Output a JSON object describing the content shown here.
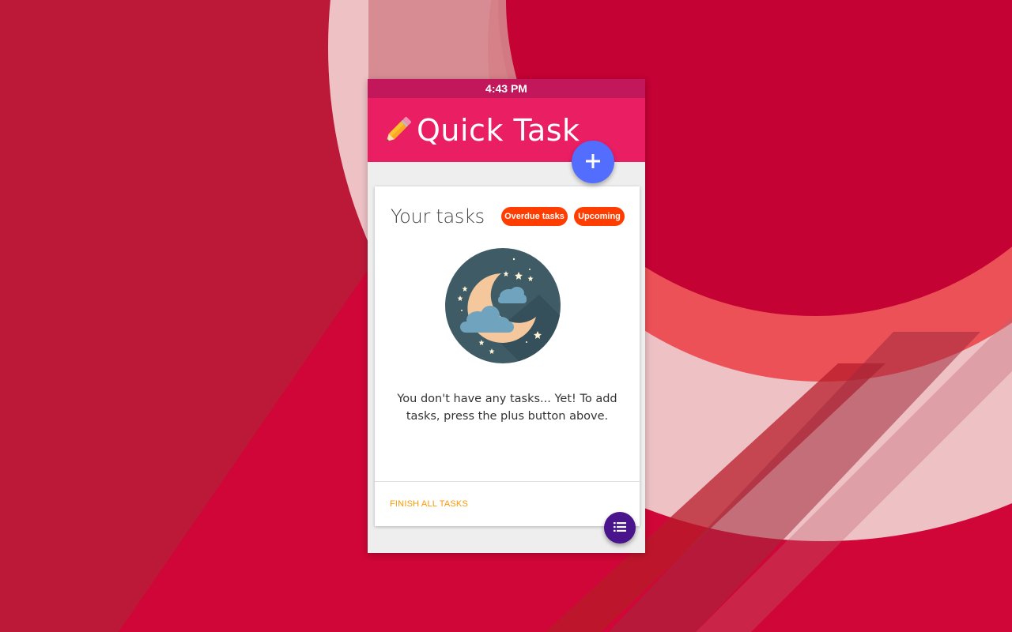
{
  "status_bar": {
    "time": "4:43 PM"
  },
  "app_bar": {
    "title": "Quick Task",
    "icon": "pencil-icon"
  },
  "fab_add": {
    "icon": "plus-icon"
  },
  "card": {
    "title": "Your tasks",
    "chips": {
      "overdue": "Overdue tasks",
      "upcoming": "Upcoming"
    },
    "illustration": "moon-night-icon",
    "empty_message": "You don't have any tasks... Yet! To add tasks, press the plus button above.",
    "finish_button": "FINISH ALL TASKS"
  },
  "fab_list": {
    "icon": "list-icon"
  },
  "colors": {
    "status_bar": "#c2185b",
    "app_bar": "#e91e63",
    "fab_add": "#536dfe",
    "chip": "#ff3d00",
    "finish_text": "#ff9800",
    "fab_list": "#4a148c",
    "background": "#bc1838"
  }
}
